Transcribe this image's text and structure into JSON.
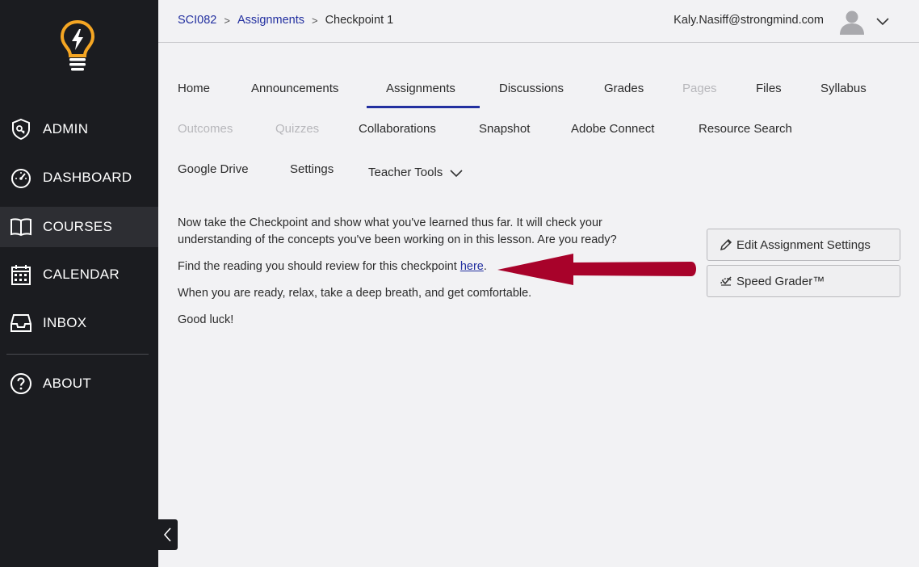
{
  "sidebar": {
    "items": [
      {
        "label": "ADMIN",
        "icon": "admin-shield-icon"
      },
      {
        "label": "DASHBOARD",
        "icon": "speedometer-icon"
      },
      {
        "label": "COURSES",
        "icon": "open-book-icon"
      },
      {
        "label": "CALENDAR",
        "icon": "calendar-icon"
      },
      {
        "label": "INBOX",
        "icon": "inbox-tray-icon"
      },
      {
        "label": "ABOUT",
        "icon": "question-circle-icon"
      }
    ],
    "active": "COURSES"
  },
  "header": {
    "breadcrumb": [
      "SCI082",
      "Assignments",
      "Checkpoint 1"
    ],
    "user_email": "Kaly.Nasiff@strongmind.com"
  },
  "course_nav": {
    "row1": [
      "Home",
      "Announcements",
      "Assignments",
      "Discussions",
      "Grades",
      "Pages",
      "Files",
      "Syllabus"
    ],
    "row2": [
      "Outcomes",
      "Quizzes",
      "Collaborations",
      "Snapshot",
      "Adobe Connect",
      "Resource Search"
    ],
    "row3": [
      "Google Drive",
      "Settings",
      "Teacher Tools"
    ],
    "active": "Assignments",
    "disabled": [
      "Pages",
      "Outcomes",
      "Quizzes"
    ]
  },
  "content": {
    "para1": "Now take the Checkpoint and show what you've learned thus far. It will check your understanding of the concepts you've been working on in this lesson. Are you ready?",
    "para2_prefix": "Find the reading you should review for this checkpoint ",
    "para2_link": "here",
    "para2_suffix": ".",
    "para3": "When you are ready, relax, take a deep breath, and get comfortable.",
    "para4": "Good luck!"
  },
  "actions": {
    "edit_settings": "Edit Assignment Settings",
    "speed_grader": "Speed Grader™"
  },
  "colors": {
    "sidebar_bg": "#1b1c20",
    "accent": "#2330a0",
    "logo": "#f5a623",
    "arrow": "#a8022a"
  }
}
